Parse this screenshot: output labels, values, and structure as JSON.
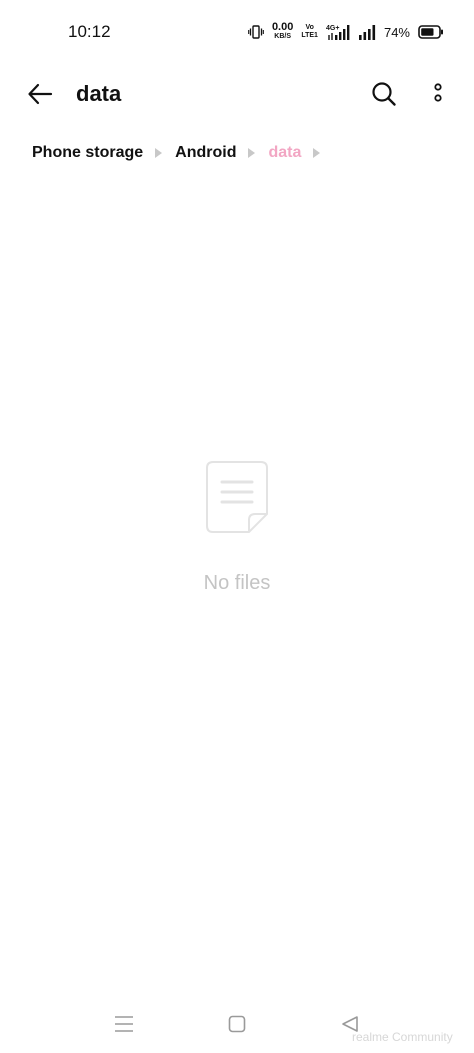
{
  "status_bar": {
    "time": "10:12",
    "net_speed_value": "0.00",
    "net_speed_unit": "KB/S",
    "volte_top": "Vo",
    "volte_bottom": "LTE1",
    "network_type": "4G+",
    "battery_percent": "74%",
    "battery_level": 0.74
  },
  "app_bar": {
    "title": "data",
    "icons": [
      "back-arrow-icon",
      "search-icon",
      "more-vertical-icon"
    ]
  },
  "breadcrumb": [
    "Phone storage",
    "Android",
    "data"
  ],
  "empty_state": {
    "icon": "document-icon",
    "message": "No files"
  },
  "nav_bar": {
    "icons": [
      "menu-icon",
      "home-icon",
      "back-triangle-icon"
    ]
  },
  "watermark": "realme Community",
  "colors": {
    "active_crumb": "#f2a6c3",
    "muted": "#c4c4c4"
  }
}
